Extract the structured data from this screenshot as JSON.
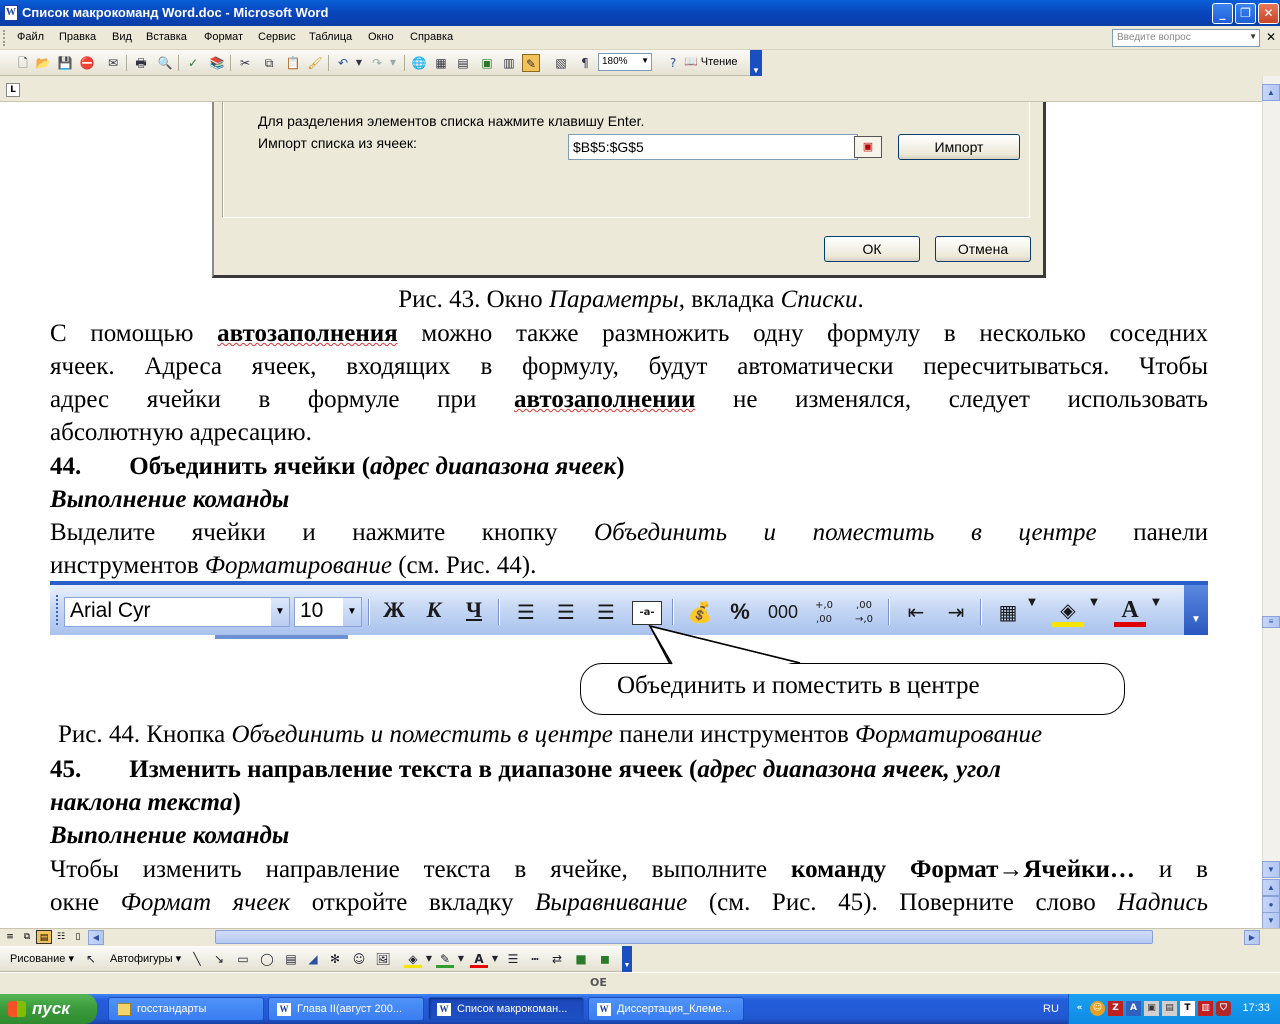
{
  "window": {
    "title": "Список макрокоманд Word.doc - Microsoft Word",
    "app_icon": "W",
    "buttons": {
      "minimize": "_",
      "restore": "❐",
      "close": "✕"
    }
  },
  "menu": {
    "items": [
      "Файл",
      "Правка",
      "Вид",
      "Вставка",
      "Формат",
      "Сервис",
      "Таблица",
      "Окно",
      "Справка"
    ],
    "help_placeholder": "Введите вопрос",
    "close_doc": "✕"
  },
  "toolbar": {
    "zoom": "180%",
    "reading_label": "Чтение",
    "pilcrow": "¶"
  },
  "ruler": {
    "tab_marker": "L"
  },
  "dialog": {
    "hint": "Для разделения элементов списка нажмите клавишу Enter.",
    "import_label": "Импорт списка из ячеек:",
    "import_value": "$B$5:$G$5",
    "import_button": "Импорт",
    "ok_button": "ОК",
    "cancel_button": "Отмена"
  },
  "document": {
    "fig43": {
      "prefix": "Рис. 43. Окно ",
      "italic1": "Параметры",
      "middle": ", вкладка ",
      "italic2": "Списки",
      "end": "."
    },
    "p1": {
      "l1a": "С помощью ",
      "l1b": "автозаполнения",
      "l1c": " можно также размножить одну формулу в несколько соседних",
      "l2": "ячеек. Адреса ячеек, входящих в формулу, будут автоматически пересчитываться. Чтобы",
      "l3a": "адрес ячейки в формуле при ",
      "l3b": "автозаполнении",
      "l3c": " не изменялся, следует использовать",
      "l4": "абсолютную адресацию."
    },
    "h44": {
      "num": "44.",
      "title": "Объединить ячейки (",
      "param": "адрес диапазона ячеек",
      "close": ")"
    },
    "exec1": "Выполнение команды",
    "p2": {
      "l1a": "Выделите ячейки и нажмите кнопку ",
      "l1b": "Объединить и поместить в центре",
      "l1c": " панели",
      "l2a": "инструментов ",
      "l2b": "Форматирование",
      "l2c": " (см. Рис. 44)."
    },
    "fmt_toolbar": {
      "font": "Arial Cyr",
      "size": "10",
      "bold": "Ж",
      "italic": "К",
      "underline": "Ч",
      "percent": "%",
      "thousands": "000",
      "inc_decimal": "+,0 ,00",
      "dec_decimal": ",00 →,0"
    },
    "callout": "Объединить и поместить в центре",
    "fig44": {
      "prefix": "Рис. 44. Кнопка ",
      "italic1": "Объединить и поместить в центре",
      "middle": " панели инструментов ",
      "italic2": "Форматирование"
    },
    "h45": {
      "num": "45.",
      "title": "Изменить направление текста в диапазоне ячеек (",
      "param1": "адрес диапазона ячеек, угол",
      "param2": "наклона текста",
      "close": ")"
    },
    "exec2": "Выполнение команды",
    "p3": {
      "l1a": "Чтобы изменить направление текста в ячейке, выполните ",
      "l1b": "команду Формат→Ячейки…",
      "l1c": " и в",
      "l2a": "окне ",
      "l2b": "Формат ячеек",
      "l2c": " откройте вкладку ",
      "l2d": "Выравнивание",
      "l2e": " (см. Рис. 45). Поверните слово ",
      "l2f": "Надпись"
    }
  },
  "drawing_toolbar": {
    "draw": "Рисование ▾",
    "autoshapes": "Автофигуры ▾"
  },
  "statusbar": {
    "mode": "ОЕ"
  },
  "taskbar": {
    "start": "пуск",
    "tasks": [
      "госстандарты",
      "Глава II(август 200...",
      "Список макрокоман...",
      "Диссертация_Клеме..."
    ],
    "language": "RU",
    "clock": "17:33"
  }
}
